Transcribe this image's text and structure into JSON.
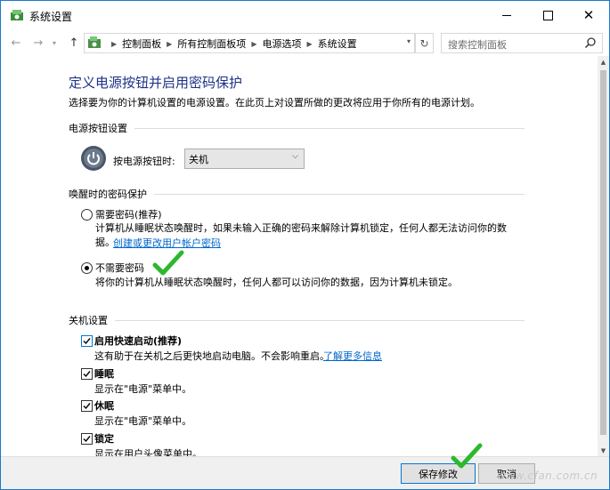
{
  "window": {
    "title": "系统设置"
  },
  "nav": {
    "breadcrumbs": [
      "控制面板",
      "所有控制面板项",
      "电源选项",
      "系统设置"
    ],
    "search_placeholder": "搜索控制面板"
  },
  "page": {
    "title": "定义电源按钮并启用密码保护",
    "description": "选择要为你的计算机设置的电源设置。在此页上对设置所做的更改将应用于你所有的电源计划。"
  },
  "power_button": {
    "section": "电源按钮设置",
    "label": "按电源按钮时:",
    "selected": "关机"
  },
  "password": {
    "section": "唤醒时的密码保护",
    "require": {
      "label": "需要密码(推荐)",
      "desc": "计算机从睡眠状态唤醒时，如果未输入正确的密码来解除计算机锁定，任何人都无法访问你的数",
      "desc2": "据。",
      "link": "创建或更改用户帐户密码",
      "selected": false
    },
    "no_require": {
      "label": "不需要密码",
      "desc": "将你的计算机从睡眠状态唤醒时，任何人都可以访问你的数据，因为计算机未锁定。",
      "selected": true
    }
  },
  "shutdown": {
    "section": "关机设置",
    "fast_startup": {
      "label": "启用快速启动(推荐)",
      "desc": "这有助于在关机之后更快地启动电脑。不会影响重启。",
      "link": "了解更多信息",
      "checked": true
    },
    "sleep": {
      "label": "睡眠",
      "desc": "显示在\"电源\"菜单中。",
      "checked": true
    },
    "hibernate": {
      "label": "休眠",
      "desc": "显示在\"电源\"菜单中。",
      "checked": true
    },
    "lock": {
      "label": "锁定",
      "desc": "显示在用户头像菜单中。",
      "checked": true
    }
  },
  "footer": {
    "save": "保存修改",
    "cancel": "取消"
  },
  "watermark": "www.cfan.com.cn",
  "colors": {
    "title_blue": "#1e3287",
    "link_blue": "#0066cc",
    "accent": "#0078d7",
    "green_check": "#2db82d"
  }
}
